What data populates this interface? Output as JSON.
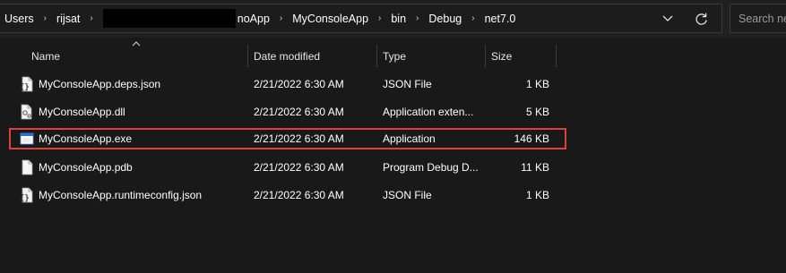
{
  "address_bar": {
    "crumbs": [
      "Users",
      "rijsat"
    ],
    "crumbs_after": [
      "noApp",
      "MyConsoleApp",
      "bin",
      "Debug",
      "net7.0"
    ],
    "separator": "›"
  },
  "search": {
    "placeholder": "Search net"
  },
  "columns": {
    "name": "Name",
    "date": "Date modified",
    "type": "Type",
    "size": "Size"
  },
  "files": [
    {
      "name": "MyConsoleApp.deps.json",
      "date": "2/21/2022 6:30 AM",
      "type": "JSON File",
      "size": "1 KB",
      "icon": "json-file-icon"
    },
    {
      "name": "MyConsoleApp.dll",
      "date": "2/21/2022 6:30 AM",
      "type": "Application exten...",
      "size": "5 KB",
      "icon": "dll-file-icon"
    },
    {
      "name": "MyConsoleApp.exe",
      "date": "2/21/2022 6:30 AM",
      "type": "Application",
      "size": "146 KB",
      "icon": "exe-file-icon",
      "highlighted": true
    },
    {
      "name": "MyConsoleApp.pdb",
      "date": "2/21/2022 6:30 AM",
      "type": "Program Debug D...",
      "size": "11 KB",
      "icon": "blank-file-icon"
    },
    {
      "name": "MyConsoleApp.runtimeconfig.json",
      "date": "2/21/2022 6:30 AM",
      "type": "JSON File",
      "size": "1 KB",
      "icon": "json-file-icon"
    }
  ],
  "colors": {
    "background": "#191919",
    "highlight_border": "#d9423f"
  }
}
